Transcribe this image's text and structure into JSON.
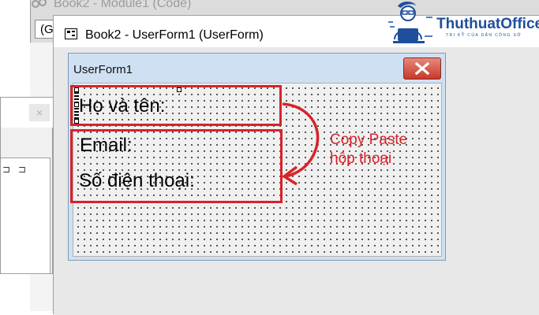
{
  "code_window": {
    "title": "Book2 - Module1 (Code)",
    "combo_value": "(G"
  },
  "left_dialog": {
    "close_glyph": "×",
    "glyphs": "⊐⊐"
  },
  "designer": {
    "title": "Book2 - UserForm1 (UserForm)"
  },
  "userform": {
    "title": "UserForm1",
    "labels": {
      "full_name": "Họ và tên:",
      "email": "Email:",
      "phone": "Số điện thoại:"
    }
  },
  "annotation": {
    "line1": "Copy Paste",
    "line2": "hộp thoại",
    "color": "#d9222a"
  },
  "logo": {
    "name": "ThuthuatOffice",
    "tagline": "TRI KỸ CỦA DÂN CÔNG SỞ",
    "color": "#1f4f9c"
  },
  "icons": {
    "designer": "userform-window-icon",
    "close": "close-icon",
    "code_window": "vba-module-icon"
  }
}
